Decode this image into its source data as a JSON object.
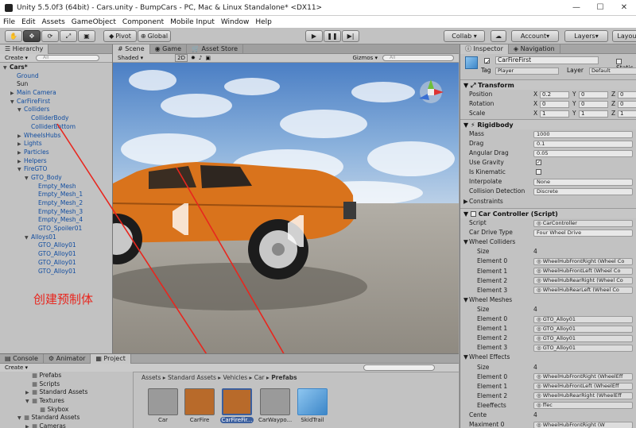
{
  "window": {
    "title": "Unity 5.5.0f3 (64bit) - Cars.unity - BumpCars - PC, Mac & Linux Standalone* <DX11>"
  },
  "menu": [
    "File",
    "Edit",
    "Assets",
    "GameObject",
    "Component",
    "Mobile Input",
    "Window",
    "Help"
  ],
  "toolbar": {
    "pivot": "Pivot",
    "global": "Global",
    "collab": "Collab ▾",
    "account": "Account",
    "layers": "Layers",
    "layout": "Layout"
  },
  "hierarchy": {
    "tab": "Hierarchy",
    "create": "Create",
    "search_placeholder": "All",
    "items": [
      {
        "label": "Cars*",
        "indent": 0,
        "plain": true,
        "arrow": "▼"
      },
      {
        "label": "Ground",
        "indent": 1
      },
      {
        "label": "Sun",
        "indent": 1,
        "plain": true
      },
      {
        "label": "Main Camera",
        "indent": 1,
        "arrow": "▶"
      },
      {
        "label": "CarFireFirst",
        "indent": 1,
        "arrow": "▼"
      },
      {
        "label": "Colliders",
        "indent": 2,
        "arrow": "▼"
      },
      {
        "label": "ColliderBody",
        "indent": 3
      },
      {
        "label": "ColliderBottom",
        "indent": 3
      },
      {
        "label": "WheelsHubs",
        "indent": 2,
        "arrow": "▶"
      },
      {
        "label": "Lights",
        "indent": 2,
        "arrow": "▶"
      },
      {
        "label": "Particles",
        "indent": 2,
        "arrow": "▶"
      },
      {
        "label": "Helpers",
        "indent": 2,
        "arrow": "▶"
      },
      {
        "label": "FireGTO",
        "indent": 2,
        "arrow": "▼"
      },
      {
        "label": "GTO_Body",
        "indent": 3,
        "arrow": "▼"
      },
      {
        "label": "Empty_Mesh",
        "indent": 4
      },
      {
        "label": "Empty_Mesh_1",
        "indent": 4
      },
      {
        "label": "Empty_Mesh_2",
        "indent": 4
      },
      {
        "label": "Empty_Mesh_3",
        "indent": 4
      },
      {
        "label": "Empty_Mesh_4",
        "indent": 4
      },
      {
        "label": "GTO_Spoiler01",
        "indent": 4
      },
      {
        "label": "Alloys01",
        "indent": 3,
        "arrow": "▼"
      },
      {
        "label": "GTO_Alloy01",
        "indent": 4
      },
      {
        "label": "GTO_Alloy01",
        "indent": 4
      },
      {
        "label": "GTO_Alloy01",
        "indent": 4
      },
      {
        "label": "GTO_Alloy01",
        "indent": 4
      }
    ]
  },
  "annotation": "创建预制体",
  "scene": {
    "tabs": [
      "Scene",
      "Game",
      "Asset Store"
    ],
    "shading": "Shaded",
    "mode2d": "2D",
    "gizmos": "Gizmos ▾",
    "search_placeholder": "All"
  },
  "bottom": {
    "tabs": [
      "Console",
      "Animator",
      "Project"
    ],
    "create": "Create",
    "folders": [
      {
        "label": "Prefabs",
        "indent": 1
      },
      {
        "label": "Scripts",
        "indent": 1
      },
      {
        "label": "Standard Assets",
        "indent": 1,
        "arrow": "▶"
      },
      {
        "label": "Textures",
        "indent": 1,
        "arrow": "▼"
      },
      {
        "label": "Skybox",
        "indent": 2
      },
      {
        "label": "Standard Assets",
        "indent": 0,
        "arrow": "▼"
      },
      {
        "label": "Cameras",
        "indent": 1,
        "arrow": "▶"
      }
    ],
    "breadcrumb": [
      "Assets",
      "Standard Assets",
      "Vehicles",
      "Car",
      "Prefabs"
    ],
    "assets": [
      "Car",
      "CarFire",
      "CarFireFir...",
      "CarWaypo...",
      "SkidTrail"
    ]
  },
  "inspector": {
    "tabs": [
      "Inspector",
      "Navigation"
    ],
    "object_name": "CarFireFirst",
    "static": "Static",
    "tag_label": "Tag",
    "tag": "Player",
    "layer_label": "Layer",
    "layer": "Default",
    "transform_title": "Transform",
    "transform": [
      {
        "label": "Position",
        "x": "0.2",
        "y": "0",
        "z": "0"
      },
      {
        "label": "Rotation",
        "x": "0",
        "y": "0",
        "z": "0"
      },
      {
        "label": "Scale",
        "x": "1",
        "y": "1",
        "z": "1"
      }
    ],
    "rigidbody_title": "Rigidbody",
    "rigidbody": [
      {
        "label": "Mass",
        "value": "1000"
      },
      {
        "label": "Drag",
        "value": "0.1"
      },
      {
        "label": "Angular Drag",
        "value": "0.05"
      },
      {
        "label": "Use Gravity",
        "check": true
      },
      {
        "label": "Is Kinematic",
        "check": false
      },
      {
        "label": "Interpolate",
        "value": "None"
      },
      {
        "label": "Collision Detection",
        "value": "Discrete"
      }
    ],
    "constraints": "Constraints",
    "controller_title": "Car Controller (Script)",
    "controller": [
      {
        "label": "Script",
        "value": "CarController",
        "obj": true,
        "indent": 0
      },
      {
        "label": "Car Drive Type",
        "value": "Four Wheel Drive",
        "indent": 0
      },
      {
        "label": "Wheel Colliders",
        "header": true
      },
      {
        "label": "Size",
        "value": "4",
        "indent": 1,
        "nobox": true
      },
      {
        "label": "Element 0",
        "value": "WheelHubFrontRight (Wheel Co",
        "indent": 1,
        "obj": true
      },
      {
        "label": "Element 1",
        "value": "WheelHubFrontLeft (Wheel Co",
        "indent": 1,
        "obj": true
      },
      {
        "label": "Element 2",
        "value": "WheelHubRearRight (Wheel Co",
        "indent": 1,
        "obj": true
      },
      {
        "label": "Element 3",
        "value": "WheelHubRearLeft (Wheel Co",
        "indent": 1,
        "obj": true
      },
      {
        "label": "Wheel Meshes",
        "header": true
      },
      {
        "label": "Size",
        "value": "4",
        "indent": 1,
        "nobox": true
      },
      {
        "label": "Element 0",
        "value": "GTO_Alloy01",
        "indent": 1,
        "obj": true
      },
      {
        "label": "Element 1",
        "value": "GTO_Alloy01",
        "indent": 1,
        "obj": true
      },
      {
        "label": "Element 2",
        "value": "GTO_Alloy01",
        "indent": 1,
        "obj": true
      },
      {
        "label": "Element 3",
        "value": "GTO_Alloy01",
        "indent": 1,
        "obj": true
      },
      {
        "label": "Wheel Effects",
        "header": true
      },
      {
        "label": "Size",
        "value": "4",
        "indent": 1,
        "nobox": true
      },
      {
        "label": "Element 0",
        "value": "WheelHubFrontRight (WheelEff",
        "indent": 1,
        "obj": true
      },
      {
        "label": "Element 1",
        "value": "WheelHubFrontLeft (WheelEff",
        "indent": 1,
        "obj": true
      },
      {
        "label": "Element 2",
        "value": "WheelHubRearRight (WheelEff",
        "indent": 1,
        "obj": true
      },
      {
        "label": "Eleeffects",
        "value": "ffec",
        "indent": 1,
        "obj": true
      },
      {
        "label": "Cente",
        "value": "4",
        "indent": 0,
        "nobox": true
      },
      {
        "label": "Maximent 0",
        "value": "WheelHubFrontRight (W",
        "indent": 0,
        "obj": true
      }
    ]
  },
  "colors": {
    "selection": "#3b5f9e",
    "hierarchy_text": "#114da0",
    "annotation": "#e8261e",
    "car_body": "#d9731c"
  }
}
